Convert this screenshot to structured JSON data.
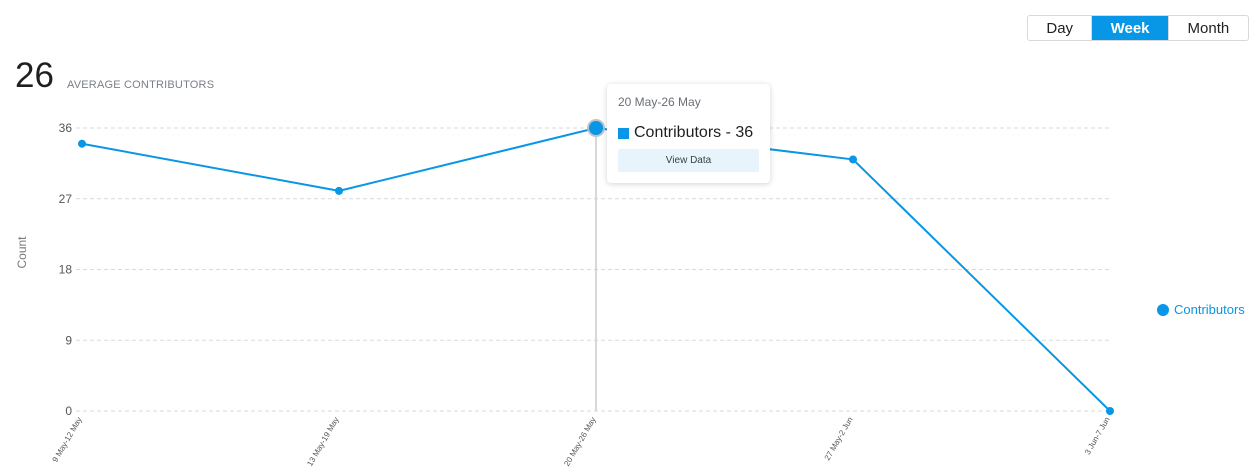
{
  "period_toggle": {
    "options": [
      "Day",
      "Week",
      "Month"
    ],
    "selected": "Week"
  },
  "metric": {
    "value": "26",
    "label": "AVERAGE CONTRIBUTORS"
  },
  "colors": {
    "accent": "#0896e6",
    "grid": "#d9d9d9",
    "crosshair": "#cccccc"
  },
  "tooltip": {
    "date": "20 May-26 May",
    "series_text": "Contributors - 36",
    "button": "View Data"
  },
  "legend": {
    "label": "Contributors",
    "icon": "circle-marker-icon"
  },
  "chart_data": {
    "type": "line",
    "categories": [
      "9 May-12 May",
      "13 May-19 May",
      "20 May-26 May",
      "27 May-2 Jun",
      "3 Jun-7 Jun"
    ],
    "series": [
      {
        "name": "Contributors",
        "values": [
          34,
          28,
          36,
          32,
          0
        ]
      }
    ],
    "xlabel": "",
    "ylabel": "Count",
    "ylim": [
      0,
      36
    ],
    "yticks": [
      0,
      9,
      18,
      27,
      36
    ],
    "grid": true,
    "legend_position": "right",
    "highlighted_category": "20 May-26 May"
  }
}
